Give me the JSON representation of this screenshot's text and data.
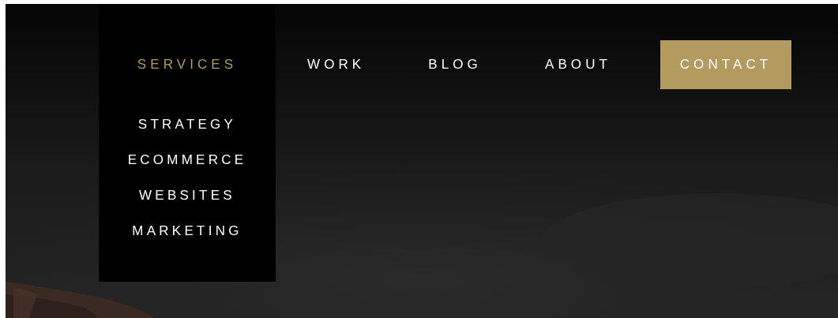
{
  "nav": [
    {
      "kind": "link",
      "label": "SERVICES",
      "selected": true,
      "expanded": true,
      "children": [
        {
          "label": "STRATEGY"
        },
        {
          "label": "ECOMMERCE"
        },
        {
          "label": "WEBSITES"
        },
        {
          "label": "MARKETING"
        }
      ]
    },
    {
      "kind": "link",
      "label": "WORK",
      "selected": false
    },
    {
      "kind": "link",
      "label": "BLOG",
      "selected": false
    },
    {
      "kind": "link",
      "label": "ABOUT",
      "selected": false
    },
    {
      "kind": "button",
      "label": "CONTACT",
      "selected": false
    }
  ]
}
